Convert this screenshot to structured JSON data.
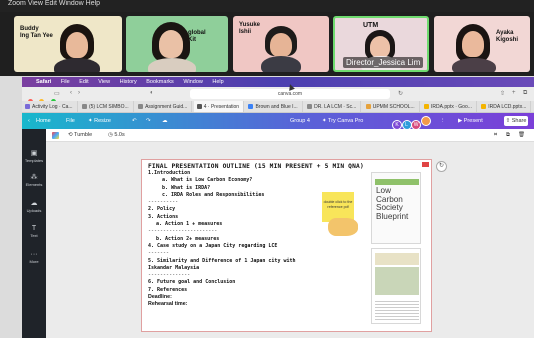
{
  "top_menu": "Zoom  View  Edit  Window  Help",
  "participants": [
    {
      "name_line1": "Buddy",
      "name_line2": "Ing Tan Yee"
    },
    {
      "name_line1": "global",
      "name_line2": "Kit"
    },
    {
      "name_line1": "Yusuke",
      "name_line2": "Ishii"
    },
    {
      "name_line1": "UTM",
      "name_line2": ""
    },
    {
      "name_line1": "Ayaka",
      "name_line2": "Kigoshi"
    }
  ],
  "active_speaker_label": "Director_Jessica Lim",
  "mac_menu": [
    "Safari",
    "File",
    "Edit",
    "View",
    "History",
    "Bookmarks",
    "Window",
    "Help"
  ],
  "browser": {
    "url": "canva.com",
    "tabs": [
      "Activity Log · Ca...",
      "(5) LCM SIMBO...",
      "Assignment Guid...",
      "4 · Presentation",
      "Brown and Blue I...",
      "DR. LA LCM · Sc...",
      "UPMM SCHOOL...",
      "IRDA.pptx · Goo...",
      "IRDA LCD.pptx..."
    ]
  },
  "canva_toolbar": {
    "home": "Home",
    "file": "File",
    "resize": "Resize",
    "group": "Group 4",
    "try_pro": "Try Canva Pro",
    "avatars": [
      "K",
      "L",
      "W"
    ],
    "present": "Present",
    "share": "Share"
  },
  "sub_toolbar": {
    "animate": "Tumble",
    "duration": "5.0s"
  },
  "left_panel": [
    "Templates",
    "Elements",
    "Uploads",
    "Text",
    "More"
  ],
  "slide": {
    "title": "FINAL PRESENTATION OUTLINE (15 MIN PRESENT + 5 MIN QNA)",
    "lines": [
      {
        "text": "1.Introduction",
        "indent": 0
      },
      {
        "text": "a. What is Low Carbon Economy?",
        "indent": 1
      },
      {
        "text": "b. What is IRDA?",
        "indent": 1
      },
      {
        "text": "c. IRDA Roles and Responsibilities",
        "indent": 1
      },
      {
        "text": "----------",
        "indent": 0,
        "sep": true
      },
      {
        "text": "2. Policy",
        "indent": 0
      },
      {
        "text": "3. Actions",
        "indent": 0
      },
      {
        "text": "a. Action 1 + measures",
        "indent": 1
      },
      {
        "text": "-----------------------",
        "indent": 0,
        "sep": true
      },
      {
        "text": "b. Action 2+ measures",
        "indent": 1
      },
      {
        "text": "4. Case study on a Japan City regarding LCE",
        "indent": 0
      },
      {
        "text": "-------",
        "indent": 0,
        "sep": true
      },
      {
        "text": "5. Similarity and Difference of 1 Japan city with",
        "indent": 0
      },
      {
        "text": "Iskandar Malaysia",
        "indent": 0
      },
      {
        "text": "--------------",
        "indent": 0,
        "sep": true
      },
      {
        "text": "6. Future goal and Conclusion",
        "indent": 0
      },
      {
        "text": "7. References",
        "indent": 0
      },
      {
        "text": "Deadline:",
        "indent": 0,
        "sans": true
      },
      {
        "text": "Rehearsal time:",
        "indent": 0,
        "sans": true
      }
    ],
    "sticky_note": "double click to the reference pdf",
    "thumb_text": [
      "Low",
      "Carbon",
      "Society",
      "Blueprint"
    ]
  }
}
